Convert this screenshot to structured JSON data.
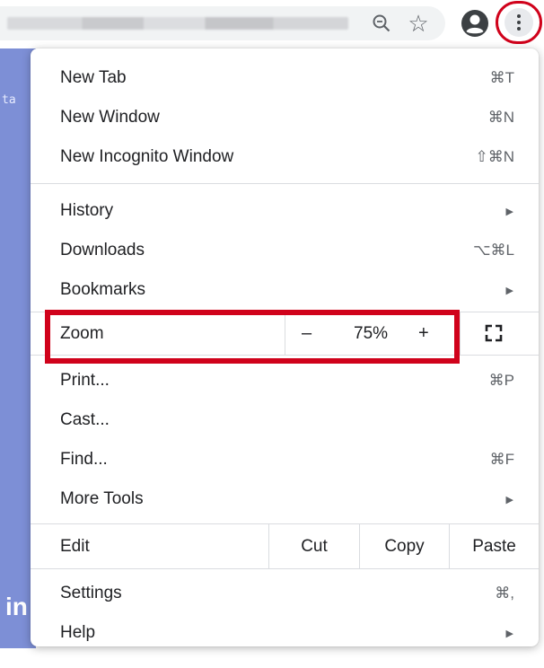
{
  "toolbar": {
    "icons": [
      "zoom-lens-icon",
      "star-icon",
      "profile-icon",
      "more-menu-icon"
    ],
    "star_glyph": "☆"
  },
  "background": {
    "side_text": "ta",
    "side_text_bottom": "in"
  },
  "menu": {
    "new_tab": {
      "label": "New Tab",
      "shortcut": "⌘T"
    },
    "new_window": {
      "label": "New Window",
      "shortcut": "⌘N"
    },
    "new_incognito": {
      "label": "New Incognito Window",
      "shortcut": "⇧⌘N"
    },
    "history": {
      "label": "History",
      "arrow": "▶"
    },
    "downloads": {
      "label": "Downloads",
      "shortcut": "⌥⌘L"
    },
    "bookmarks": {
      "label": "Bookmarks",
      "arrow": "▶"
    },
    "zoom": {
      "label": "Zoom",
      "minus": "–",
      "value": "75%",
      "plus": "+"
    },
    "print": {
      "label": "Print...",
      "shortcut": "⌘P"
    },
    "cast": {
      "label": "Cast..."
    },
    "find": {
      "label": "Find...",
      "shortcut": "⌘F"
    },
    "more_tools": {
      "label": "More Tools",
      "arrow": "▶"
    },
    "edit": {
      "label": "Edit",
      "cut": "Cut",
      "copy": "Copy",
      "paste": "Paste"
    },
    "settings": {
      "label": "Settings",
      "shortcut": "⌘,"
    },
    "help": {
      "label": "Help",
      "arrow": "▶"
    }
  },
  "colors": {
    "highlight": "#d0021b",
    "page_accent": "#7d8fd6",
    "separator": "#dadce0"
  }
}
